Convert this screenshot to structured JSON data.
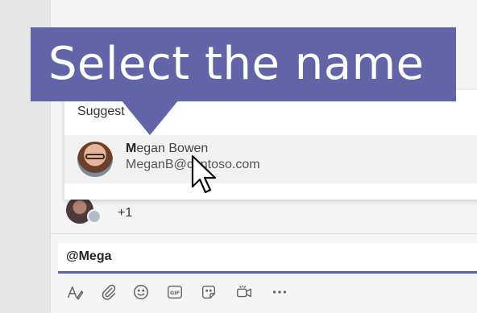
{
  "callout": {
    "text": "Select the name"
  },
  "suggestions": {
    "heading": "Suggest",
    "item": {
      "name_match": "M",
      "name_rest": "egan Bowen",
      "email": "MeganB@contoso.com"
    }
  },
  "participants": {
    "extra_count": "+1"
  },
  "compose": {
    "text": "@Mega"
  },
  "toolbar": {
    "icons": [
      "format-icon",
      "attach-icon",
      "emoji-icon",
      "gif-icon",
      "sticker-icon",
      "meet-now-icon",
      "more-options-icon"
    ]
  },
  "colors": {
    "accent": "#6264a7",
    "banner_text": "#ffffff"
  }
}
